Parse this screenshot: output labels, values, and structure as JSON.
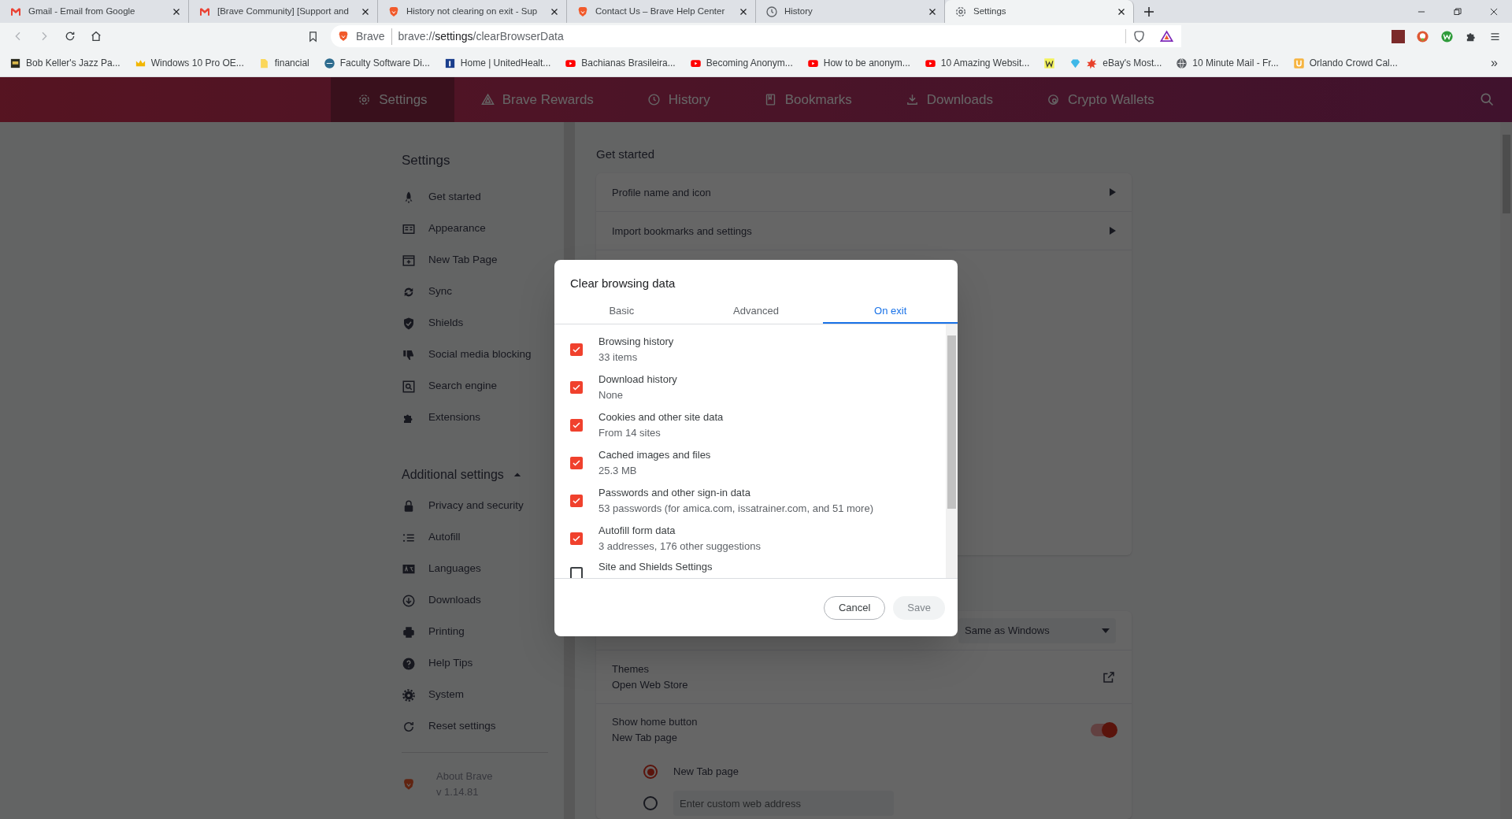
{
  "browser_tabs": [
    {
      "title": "Gmail - Email from Google",
      "selected": false
    },
    {
      "title": "[Brave Community] [Support and",
      "selected": false
    },
    {
      "title": "History not clearing on exit - Sup",
      "selected": false
    },
    {
      "title": "Contact Us – Brave Help Center",
      "selected": false
    },
    {
      "title": "History",
      "selected": false
    },
    {
      "title": "Settings",
      "selected": true
    }
  ],
  "address_bar": {
    "site": "Brave",
    "url_prefix": "brave://",
    "url_host": "settings",
    "url_path": "/clearBrowserData"
  },
  "bookmarks": [
    {
      "label": "Bob Keller's Jazz Pa..."
    },
    {
      "label": "Windows 10 Pro OE..."
    },
    {
      "label": "financial"
    },
    {
      "label": "Faculty Software Di..."
    },
    {
      "label": "Home | UnitedHealt..."
    },
    {
      "label": "Bachianas Brasileira..."
    },
    {
      "label": "Becoming Anonym..."
    },
    {
      "label": "How to be anonym..."
    },
    {
      "label": "10 Amazing Websit..."
    },
    {
      "kind": "icon_only"
    },
    {
      "label": "eBay's Most..."
    },
    {
      "label": "10 Minute Mail - Fr..."
    },
    {
      "label": "Orlando Crowd Cal..."
    }
  ],
  "overflow_chevron": "»",
  "nav": [
    {
      "label": "Settings",
      "selected": true
    },
    {
      "label": "Brave Rewards",
      "selected": false
    },
    {
      "label": "History",
      "selected": false
    },
    {
      "label": "Bookmarks",
      "selected": false
    },
    {
      "label": "Downloads",
      "selected": false
    },
    {
      "label": "Crypto Wallets",
      "selected": false
    }
  ],
  "sidebar": {
    "title": "Settings",
    "items": [
      {
        "label": "Get started"
      },
      {
        "label": "Appearance"
      },
      {
        "label": "New Tab Page"
      },
      {
        "label": "Sync"
      },
      {
        "label": "Shields"
      },
      {
        "label": "Social media blocking"
      },
      {
        "label": "Search engine"
      },
      {
        "label": "Extensions"
      }
    ],
    "additional": {
      "label": "Additional settings",
      "expanded": true,
      "items": [
        {
          "label": "Privacy and security"
        },
        {
          "label": "Autofill"
        },
        {
          "label": "Languages"
        },
        {
          "label": "Downloads"
        },
        {
          "label": "Printing"
        },
        {
          "label": "Help Tips"
        },
        {
          "label": "System"
        },
        {
          "label": "Reset settings"
        }
      ]
    },
    "about": {
      "label": "About Brave",
      "version": "v 1.14.81"
    }
  },
  "get_started": {
    "heading": "Get started",
    "rows": [
      {
        "label": "Profile name and icon"
      },
      {
        "label": "Import bookmarks and settings"
      }
    ]
  },
  "appearance": {
    "theme_dropdown": "Same as Windows",
    "themes": {
      "label": "Themes",
      "sublabel": "Open Web Store"
    },
    "home_button": {
      "label": "Show home button",
      "sublabel": "New Tab page",
      "on": true
    },
    "home_options": [
      {
        "label": "New Tab page",
        "selected": true
      },
      {
        "placeholder": "Enter custom web address",
        "selected": false
      }
    ]
  },
  "dialog": {
    "title": "Clear browsing data",
    "tabs": [
      {
        "label": "Basic",
        "selected": false
      },
      {
        "label": "Advanced",
        "selected": false
      },
      {
        "label": "On exit",
        "selected": true
      }
    ],
    "items": [
      {
        "label": "Browsing history",
        "detail": "33 items",
        "checked": true
      },
      {
        "label": "Download history",
        "detail": "None",
        "checked": true
      },
      {
        "label": "Cookies and other site data",
        "detail": "From 14 sites",
        "checked": true
      },
      {
        "label": "Cached images and files",
        "detail": "25.3 MB",
        "checked": true
      },
      {
        "label": "Passwords and other sign-in data",
        "detail": "53 passwords (for amica.com, issatrainer.com, and 51 more)",
        "checked": true
      },
      {
        "label": "Autofill form data",
        "detail": "3 addresses, 176 other suggestions",
        "checked": true
      },
      {
        "label": "Site and Shields Settings",
        "checked": false
      }
    ],
    "buttons": [
      {
        "label": "Cancel",
        "disabled": false
      },
      {
        "label": "Save",
        "disabled": true
      }
    ]
  }
}
